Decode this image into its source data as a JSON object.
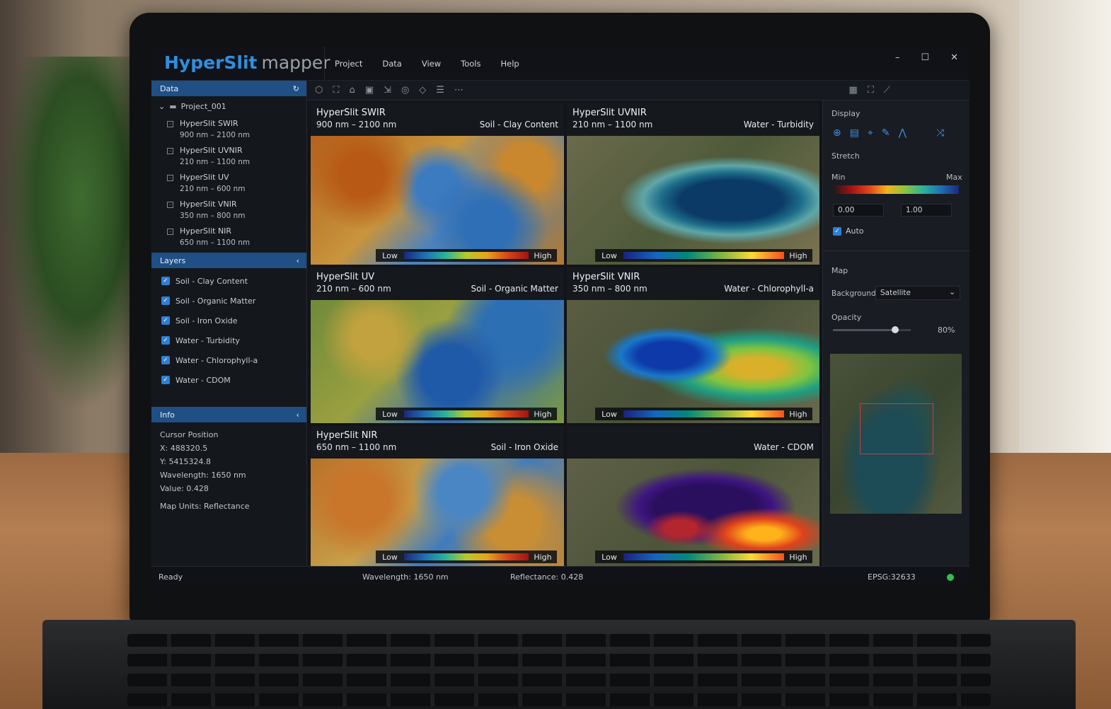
{
  "app": {
    "brand_primary": "HyperSlit",
    "brand_secondary": "mapper"
  },
  "menu": [
    "Project",
    "Data",
    "View",
    "Tools",
    "Help"
  ],
  "window_controls": {
    "minimize": "–",
    "maximize": "☐",
    "close": "✕"
  },
  "data_panel": {
    "title": "Data",
    "project": "Project_001",
    "datasets": [
      {
        "name": "HyperSlit SWIR",
        "range": "900 nm – 2100 nm"
      },
      {
        "name": "HyperSlit UVNIR",
        "range": "210 nm – 1100 nm"
      },
      {
        "name": "HyperSlit UV",
        "range": "210 nm – 600 nm"
      },
      {
        "name": "HyperSlit VNIR",
        "range": "350 nm – 800 nm"
      },
      {
        "name": "HyperSlit NIR",
        "range": "650 nm – 1100 nm"
      }
    ]
  },
  "layers_panel": {
    "title": "Layers",
    "items": [
      {
        "label": "Soil - Clay Content",
        "checked": true
      },
      {
        "label": "Soil - Organic Matter",
        "checked": true
      },
      {
        "label": "Soil - Iron Oxide",
        "checked": true
      },
      {
        "label": "Water - Turbidity",
        "checked": true
      },
      {
        "label": "Water - Chlorophyll-a",
        "checked": true
      },
      {
        "label": "Water - CDOM",
        "checked": true
      }
    ]
  },
  "info_panel": {
    "title": "Info",
    "cursor_title": "Cursor Position",
    "x": "X:  488320.5",
    "y": "Y:  5415324.8",
    "wavelength": "Wavelength:  1650 nm",
    "value": "Value:  0.428",
    "map_units": "Map Units:  Reflectance"
  },
  "panels": [
    {
      "title": "HyperSlit SWIR",
      "range": "900 nm – 2100 nm",
      "layer": "Soil - Clay Content",
      "low": "Low",
      "high": "High"
    },
    {
      "title": "HyperSlit UVNIR",
      "range": "210 nm – 1100 nm",
      "layer": "Water - Turbidity",
      "low": "Low",
      "high": "High"
    },
    {
      "title": "HyperSlit UV",
      "range": "210 nm – 600 nm",
      "layer": "Soil - Organic Matter",
      "low": "Low",
      "high": "High"
    },
    {
      "title": "HyperSlit VNIR",
      "range": "350 nm – 800 nm",
      "layer": "Water - Chlorophyll-a",
      "low": "Low",
      "high": "High"
    },
    {
      "title": "HyperSlit NIR",
      "range": "650 nm – 1100 nm",
      "layer": "Soil - Iron Oxide",
      "low": "Low",
      "high": "High"
    },
    {
      "title": "",
      "range": "",
      "layer": "Water - CDOM",
      "low": "Low",
      "high": "High"
    }
  ],
  "display_panel": {
    "title": "Display",
    "stretch_label": "Stretch",
    "min_label": "Min",
    "max_label": "Max",
    "min_value": "0.00",
    "max_value": "1.00",
    "auto_label": "Auto",
    "auto_checked": true
  },
  "map_panel": {
    "title": "Map",
    "background_label": "Background",
    "background_value": "Satellite",
    "opacity_label": "Opacity",
    "opacity_value": "80%",
    "opacity_level": 0.8
  },
  "status": {
    "state": "Ready",
    "wavelength": "Wavelength:  1650 nm",
    "reflectance": "Reflectance:  0.428",
    "crs": "EPSG:32633",
    "indicator_color": "#2fbf4f"
  },
  "colors": {
    "accent": "#2f8fe0",
    "section_header": "#1f4f85"
  }
}
